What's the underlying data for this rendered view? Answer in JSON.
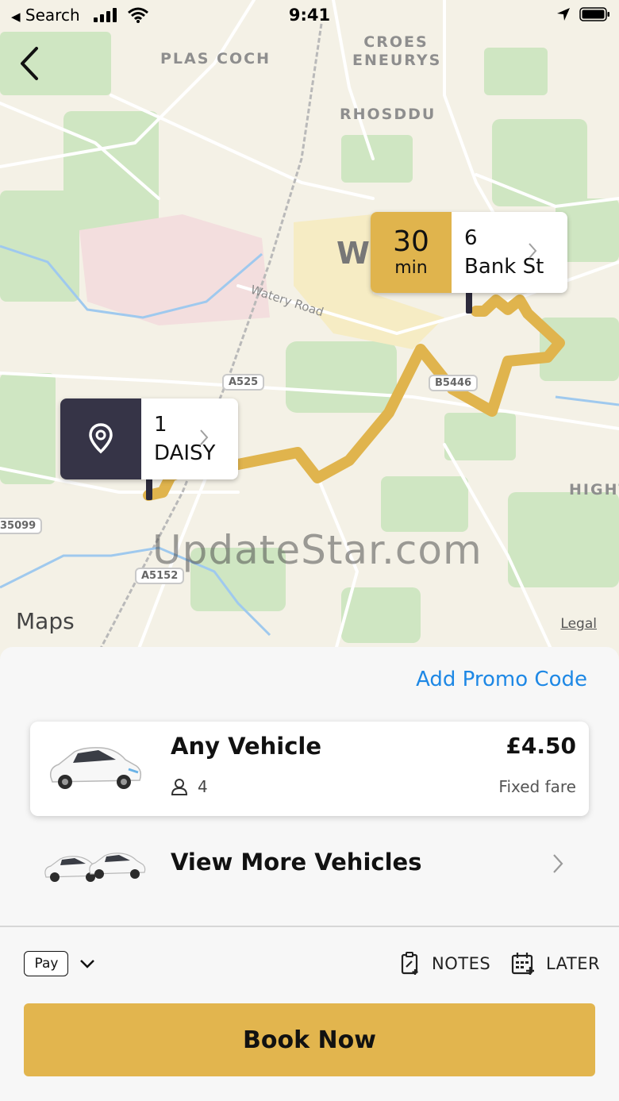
{
  "status_bar": {
    "back_app": "Search",
    "time": "9:41"
  },
  "map": {
    "places": [
      "PLAS COCH",
      "CROES",
      "ENEURYS",
      "RHOSDDU",
      "W",
      "HIGHT"
    ],
    "roads": {
      "shields": [
        "A525",
        "B5446",
        "A5152",
        "35099"
      ],
      "road_name": "Watery Road"
    },
    "route_color": "#e0b44d",
    "destination": {
      "eta_value": "30",
      "eta_unit": "min",
      "number": "6",
      "street": "Bank St",
      "color": "#e0b44d"
    },
    "pickup": {
      "number": "1",
      "street": "DAISY",
      "icon": "location-pin-icon",
      "color": "#363447"
    },
    "attribution": "Maps",
    "legal": "Legal",
    "watermark": "UpdateStar.com"
  },
  "sheet": {
    "promo": "Add Promo Code",
    "vehicle": {
      "name": "Any Vehicle",
      "seats": "4",
      "price": "£4.50",
      "fare_type": "Fixed fare",
      "icon": "car-icon"
    },
    "more_vehicles": "View More Vehicles",
    "payment": {
      "label": "Pay",
      "icon": "apple-pay-icon"
    },
    "notes": "NOTES",
    "later": "LATER",
    "book": "Book Now",
    "accent_color": "#e2b54e",
    "link_color": "#1e88e5"
  }
}
